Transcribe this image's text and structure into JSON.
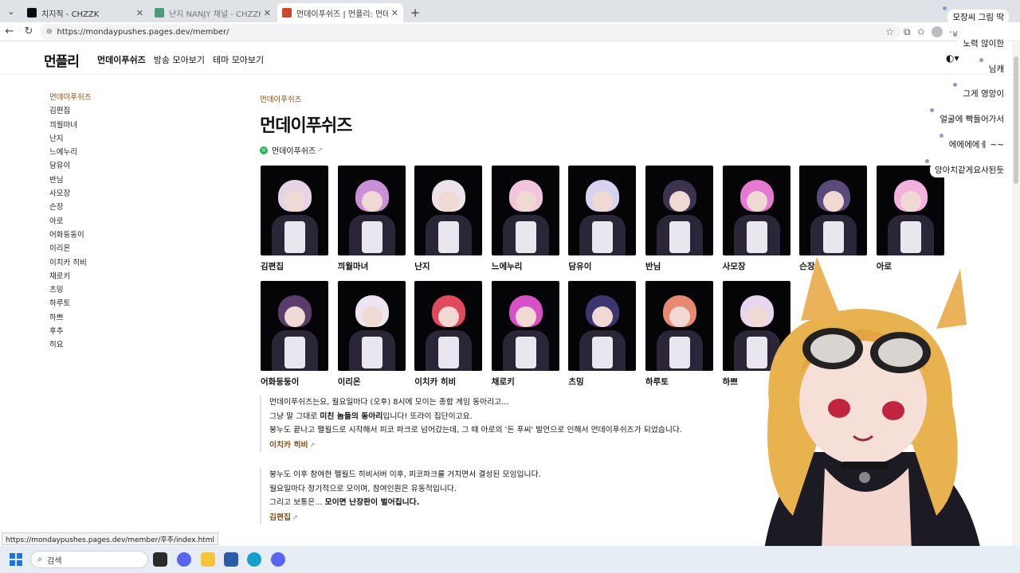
{
  "browser": {
    "tabs": [
      {
        "title": "치지직 - CHZZK",
        "fav_color": "#0b0b0b",
        "active": false,
        "dim": false
      },
      {
        "title": "난지 NANJY 채널 - CHZZK",
        "fav_color": "#4a9b7a",
        "active": false,
        "dim": true
      },
      {
        "title": "먼데이푸쉬즈 | 먼플리: 먼데이푸쉬즈",
        "fav_color": "#d2452f",
        "active": true,
        "dim": false
      }
    ],
    "new_tab": "+",
    "close_glyph": "✕",
    "menu_glyph": "⌄",
    "url": "https://mondaypushes.pages.dev/member/"
  },
  "site": {
    "logo": "먼플리",
    "nav": [
      "먼데이푸쉬즈",
      "방송 모아보기",
      "테마 모아보기"
    ],
    "theme_toggle": "◐▾"
  },
  "sidebar": {
    "items": [
      "먼데이푸쉬즈",
      "김편집",
      "끠월마녀",
      "난지",
      "느에누리",
      "담유이",
      "반님",
      "사모장",
      "슨장",
      "아로",
      "어화둥둥이",
      "이리온",
      "이치카 히비",
      "채로키",
      "츠밍",
      "하루토",
      "하쁘",
      "후추",
      "히요"
    ]
  },
  "main": {
    "breadcrumb": "먼데이푸쉬즈",
    "title": "먼데이푸쉬즈",
    "channel_link": "먼데이푸쉬즈",
    "members": [
      {
        "name": "김편집",
        "hair": "#e7d3e8"
      },
      {
        "name": "끠월마녀",
        "hair": "#c98fd9"
      },
      {
        "name": "난지",
        "hair": "#eee2ea"
      },
      {
        "name": "느에누리",
        "hair": "#f3c5dc"
      },
      {
        "name": "담유이",
        "hair": "#d8d2f0"
      },
      {
        "name": "반님",
        "hair": "#3b3350"
      },
      {
        "name": "사모장",
        "hair": "#e57ad0"
      },
      {
        "name": "슨장",
        "hair": "#5a4a7a"
      },
      {
        "name": "아로",
        "hair": "#f2b2dd"
      },
      {
        "name": "어화둥둥이",
        "hair": "#5b3d6b"
      },
      {
        "name": "이리온",
        "hair": "#ece4f0"
      },
      {
        "name": "이치카 히비",
        "hair": "#e04a5a"
      },
      {
        "name": "채로키",
        "hair": "#d84fc6"
      },
      {
        "name": "츠밍",
        "hair": "#3d3570"
      },
      {
        "name": "하루토",
        "hair": "#e98a70"
      },
      {
        "name": "하쁘",
        "hair": "#e6d6f0"
      }
    ],
    "quote1": {
      "line1": "먼데이푸쉬즈는요, 월요일마다 (오후) 8시에 모이는 종합 게임 동아리고...",
      "line2_pre": "그냥 말 그대로 ",
      "line2_bold": "미친 놈들의 동아리",
      "line2_post": "입니다! 또라이 집단이고요.",
      "line3": "붕누도 끝나고 팰월드로 시작해서 피코 파크로 넘어갔는데, 그 때 아로의 '돈 푸씨' 발언으로 인해서 먼데이푸쉬즈가 되었습니다.",
      "author": "이치카 히비"
    },
    "quote2": {
      "line1": "붕누도 이후 참여한 팰월드 히비서버 이후, 피코파크를 거치면서 결성된 모임입니다.",
      "line2": "월요일마다 정기적으로 모이며, 참여인원은 유동적입니다.",
      "line3_pre": "그리고 보통은... ",
      "line3_bold": "모이면 난장판이 벌어집니다.",
      "author": "김편집"
    }
  },
  "chat": [
    {
      "text": "모장씨 그림 딱"
    },
    {
      "text": "노력 않이한"
    },
    {
      "text": "님캐"
    },
    {
      "text": "그게 영앙이"
    },
    {
      "text": "얼굴에 빡들어가서"
    },
    {
      "text": "에에에에ㅔ ~~"
    },
    {
      "text": "앙아치같게요사된듯"
    }
  ],
  "status_url": "https://mondaypushes.pages.dev/member/후추/index.html",
  "taskbar": {
    "search_placeholder": "검색"
  }
}
